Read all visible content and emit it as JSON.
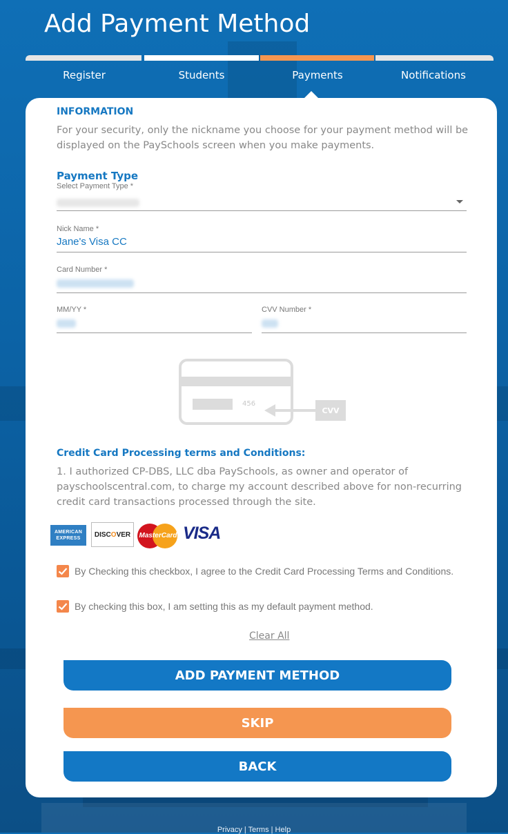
{
  "page": {
    "title": "Add Payment Method"
  },
  "steps": [
    {
      "label": "Register",
      "status": "complete"
    },
    {
      "label": "Students",
      "status": "complete"
    },
    {
      "label": "Payments",
      "status": "active"
    },
    {
      "label": "Notifications",
      "status": "pending"
    }
  ],
  "info": {
    "heading": "INFORMATION",
    "text": "For your security, only the nickname you choose for your payment method will be displayed on the PaySchools screen when you make payments."
  },
  "payment_type": {
    "heading": "Payment Type",
    "select_label": "Select Payment Type *"
  },
  "fields": {
    "nickname_label": "Nick Name *",
    "nickname_value": "Jane's Visa CC",
    "card_number_label": "Card Number *",
    "expiry_label": "MM/YY *",
    "cvv_label": "CVV Number *"
  },
  "card_illustration": {
    "number": "456",
    "cvv_tag": "CVV"
  },
  "terms": {
    "heading": "Credit Card Processing terms and Conditions:",
    "text": "1. I authorized CP-DBS, LLC dba PaySchools, as owner and operator of payschoolscentral.com, to charge my account described above for non-recurring credit card transactions processed through the site."
  },
  "logos": {
    "amex_line1": "AMERICAN",
    "amex_line2": "EXPRESS",
    "discover": "DISC",
    "discover_o": "O",
    "discover_end": "VER",
    "mastercard": "MasterCard",
    "visa": "VISA"
  },
  "checkboxes": [
    {
      "label": "By Checking this checkbox, I agree to the Credit Card Processing Terms and Conditions.",
      "checked": true
    },
    {
      "label": "By checking this box, I am setting this as my default payment method.",
      "checked": true
    }
  ],
  "links": {
    "clear_all": "Clear All"
  },
  "buttons": {
    "add": "ADD PAYMENT METHOD",
    "skip": "SKIP",
    "back": "BACK"
  },
  "footer": {
    "links": "Privacy | Terms | Help"
  },
  "colors": {
    "primary": "#1378c5",
    "accent": "#f59650",
    "step_complete": "#e5e5e5",
    "step_active": "#f59650"
  }
}
